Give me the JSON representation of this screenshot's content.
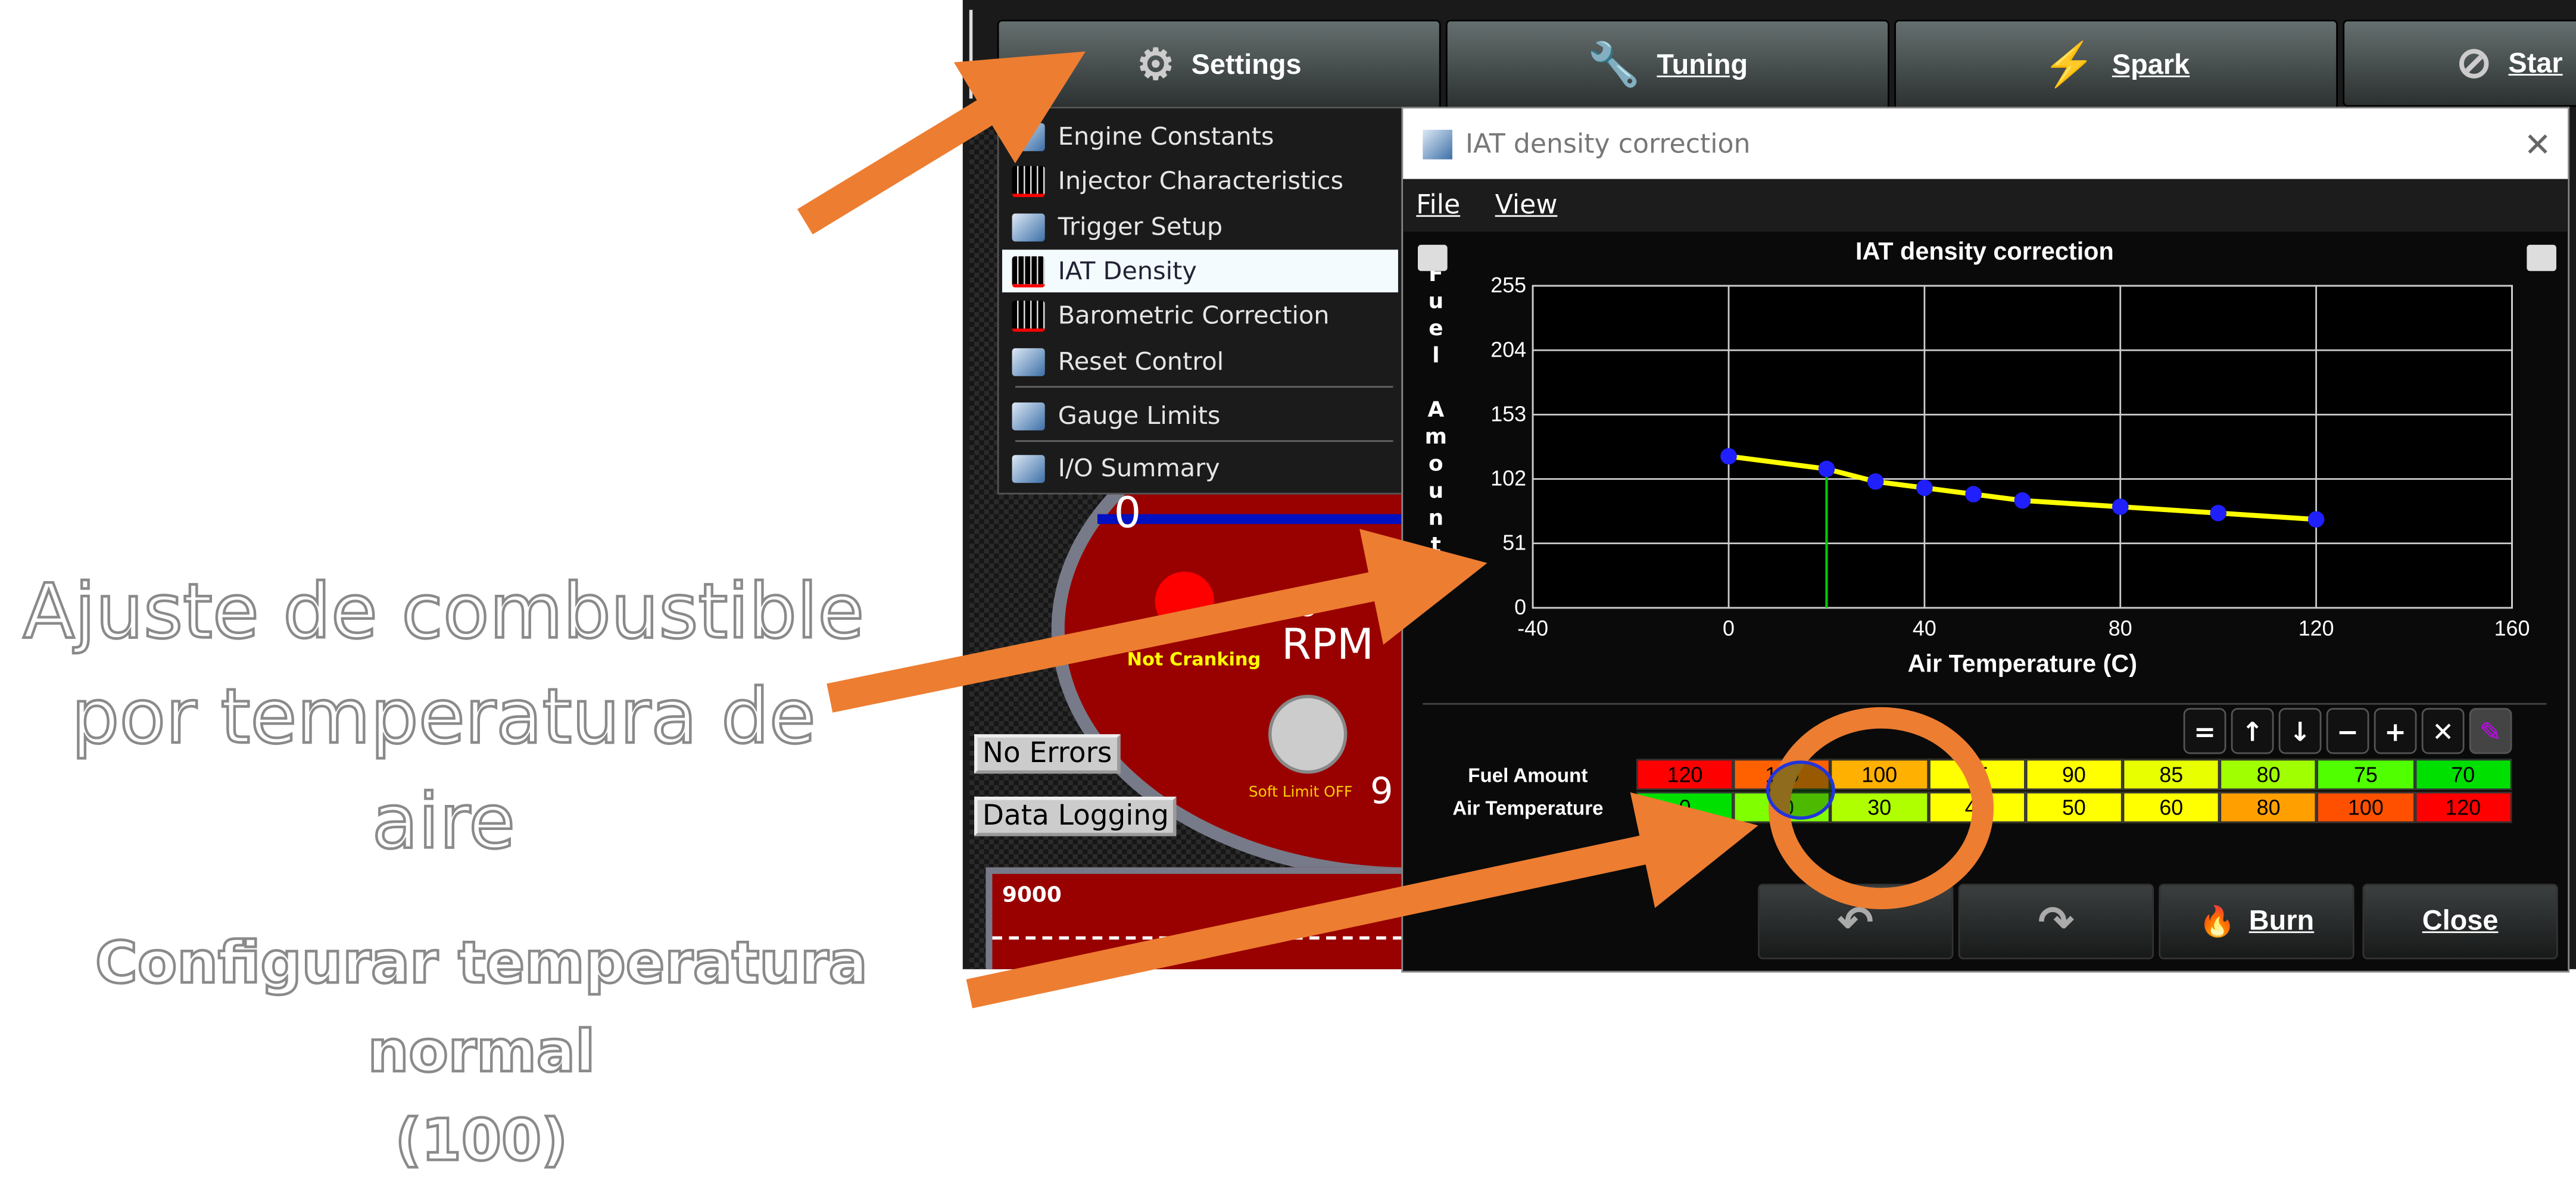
{
  "toolbar": {
    "items": [
      {
        "label": "Settings",
        "icon": "gear-icon"
      },
      {
        "label": "Tuning",
        "icon": "wrench-icon"
      },
      {
        "label": "Spark",
        "icon": "spark-plug-icon"
      },
      {
        "label": "Star",
        "icon": "start-icon"
      }
    ]
  },
  "settings_menu": {
    "items": [
      "Engine Constants",
      "Injector Characteristics",
      "Trigger Setup",
      "IAT Density",
      "Barometric Correction",
      "Reset Control",
      "Gauge Limits",
      "I/O Summary"
    ],
    "selected": "IAT Density"
  },
  "dashboard": {
    "rpm_label": "RPM",
    "rpm_value": "0",
    "needle_value": "0",
    "cranking": "Not Cranking",
    "soft_limit": "Soft Limit OFF",
    "gauge_edge": "9",
    "no_errors": "No Errors",
    "data_logging": "Data Logging",
    "histogram_max": "9000"
  },
  "dialog": {
    "title": "IAT density correction",
    "menu": [
      "File",
      "View"
    ],
    "close_icon": "close-icon",
    "table": {
      "row_labels": [
        "Fuel Amount",
        "Air Temperature"
      ],
      "fuel": [
        "120",
        "110",
        "100",
        "95",
        "90",
        "85",
        "80",
        "75",
        "70"
      ],
      "temp": [
        "0",
        "20",
        "30",
        "40",
        "50",
        "60",
        "80",
        "100",
        "120"
      ],
      "fuel_colors": [
        "#ff0000",
        "#ff6000",
        "#ffb000",
        "#ffff00",
        "#ffff00",
        "#e8ff00",
        "#a0ff00",
        "#50ff00",
        "#00e000"
      ],
      "temp_colors": [
        "#00e000",
        "#80ff00",
        "#b0ff00",
        "#ffff00",
        "#ffff00",
        "#ffff00",
        "#ffa000",
        "#ff5000",
        "#ff0000"
      ]
    },
    "table_tools": [
      "=",
      "↑",
      "↓",
      "−",
      "+",
      "✕"
    ],
    "buttons": {
      "burn": "Burn",
      "close": "Close"
    }
  },
  "chart_data": {
    "type": "line",
    "title": "IAT density correction",
    "xlabel": "Air Temperature (C)",
    "ylabel": "Fuel Amount",
    "xlim": [
      -40,
      160
    ],
    "ylim": [
      0,
      255
    ],
    "xticks": [
      "-40",
      "0",
      "40",
      "80",
      "120",
      "160"
    ],
    "yticks": [
      "0",
      "51",
      "102",
      "153",
      "204",
      "255"
    ],
    "x": [
      0,
      20,
      30,
      40,
      50,
      60,
      80,
      100,
      120
    ],
    "y": [
      120,
      110,
      100,
      95,
      90,
      85,
      80,
      75,
      70
    ],
    "line_color": "#ffff00",
    "point_color": "#2020ff",
    "cursor_x": 20,
    "grid": true
  },
  "annotations": {
    "main": [
      "Ajuste de combustible",
      "por temperatura de",
      "aire"
    ],
    "sub": [
      "Configurar temperatura normal",
      "(100)"
    ],
    "color": "#ed7d31"
  }
}
